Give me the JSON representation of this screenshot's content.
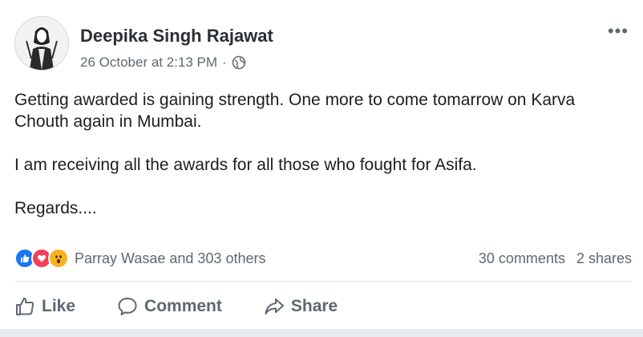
{
  "post": {
    "author": "Deepika Singh Rajawat",
    "timestamp": "26 October at 2:13 PM",
    "separator": "·",
    "privacy_icon": "globe-icon",
    "more_label": "•••",
    "paragraphs": [
      "Getting awarded is gaining strength. One more to come tomarrow on Karva Chouth again in Mumbai.",
      "I am receiving all the awards for all those who fought for Asifa.",
      "Regards...."
    ]
  },
  "reactions": {
    "icons": [
      "like-icon",
      "love-icon",
      "wow-icon"
    ],
    "names": "Parray Wasae and 303 others",
    "comments": "30 comments",
    "shares": "2 shares"
  },
  "actions": {
    "like": "Like",
    "comment": "Comment",
    "share": "Share"
  },
  "colors": {
    "like_blue": "#1877f2",
    "love_red": "#f33e58",
    "wow_yellow": "#f7b125",
    "secondary_text": "#616770"
  }
}
